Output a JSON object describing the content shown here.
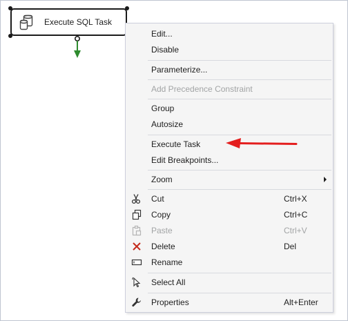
{
  "task": {
    "label": "Execute SQL Task"
  },
  "menu": {
    "items": [
      {
        "label": "Edit...",
        "shortcut": "",
        "enabled": true
      },
      {
        "label": "Disable",
        "shortcut": "",
        "enabled": true
      },
      {
        "label": "Parameterize...",
        "shortcut": "",
        "enabled": true
      },
      {
        "label": "Add Precedence Constraint",
        "shortcut": "",
        "enabled": false
      },
      {
        "label": "Group",
        "shortcut": "",
        "enabled": true
      },
      {
        "label": "Autosize",
        "shortcut": "",
        "enabled": true
      },
      {
        "label": "Execute Task",
        "shortcut": "",
        "enabled": true
      },
      {
        "label": "Edit Breakpoints...",
        "shortcut": "",
        "enabled": true
      },
      {
        "label": "Zoom",
        "shortcut": "",
        "enabled": true,
        "submenu": true
      },
      {
        "label": "Cut",
        "shortcut": "Ctrl+X",
        "enabled": true,
        "icon": "scissors-icon"
      },
      {
        "label": "Copy",
        "shortcut": "Ctrl+C",
        "enabled": true,
        "icon": "copy-icon"
      },
      {
        "label": "Paste",
        "shortcut": "Ctrl+V",
        "enabled": false,
        "icon": "paste-icon"
      },
      {
        "label": "Delete",
        "shortcut": "Del",
        "enabled": true,
        "icon": "delete-x-icon"
      },
      {
        "label": "Rename",
        "shortcut": "",
        "enabled": true,
        "icon": "rename-icon"
      },
      {
        "label": "Select All",
        "shortcut": "",
        "enabled": true,
        "icon": "select-all-cursor-icon"
      },
      {
        "label": "Properties",
        "shortcut": "Alt+Enter",
        "enabled": true,
        "icon": "wrench-icon"
      }
    ]
  },
  "colors": {
    "menu_bg": "#f5f5f5",
    "disabled_text": "#a2a4a5",
    "delete_icon": "#c42b1c",
    "connector_green": "#2e8b2e",
    "annotation_arrow": "#e41e1e"
  }
}
